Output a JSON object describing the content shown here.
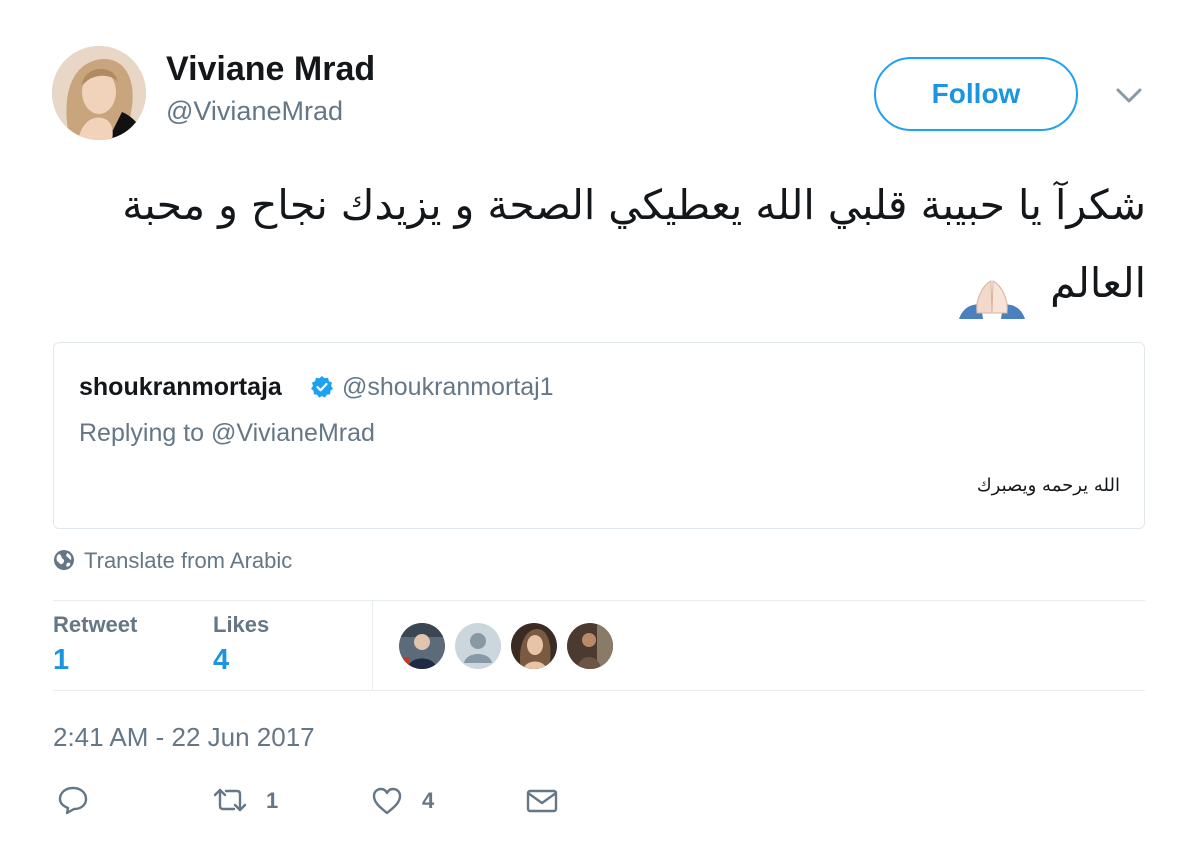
{
  "author": {
    "display_name": "Viviane Mrad",
    "handle": "@VivianeMrad"
  },
  "follow_button": {
    "label": "Follow"
  },
  "tweet": {
    "line1": "شكرآ يا حبيبة قلبي الله يعطيكي الصحة و يزيدك نجاح و محبة",
    "line2": "العالم",
    "emoji": "folded-hands-icon"
  },
  "quoted_tweet": {
    "name": "shoukranmortaja",
    "verified": true,
    "handle": "@shoukranmortaj1",
    "replying_to": "Replying to @VivianeMrad",
    "text": "الله يرحمه ويصبرك"
  },
  "translate": {
    "label": "Translate from Arabic"
  },
  "stats": {
    "retweet_label": "Retweet",
    "retweet_count": "1",
    "likes_label": "Likes",
    "likes_count": "4"
  },
  "timestamp": "2:41 AM - 22 Jun 2017",
  "actions": {
    "retweet_count": "1",
    "like_count": "4"
  },
  "colors": {
    "accent": "#1da1f2",
    "link": "#1b95e0",
    "muted": "#657786",
    "border": "#e1e8ed"
  }
}
